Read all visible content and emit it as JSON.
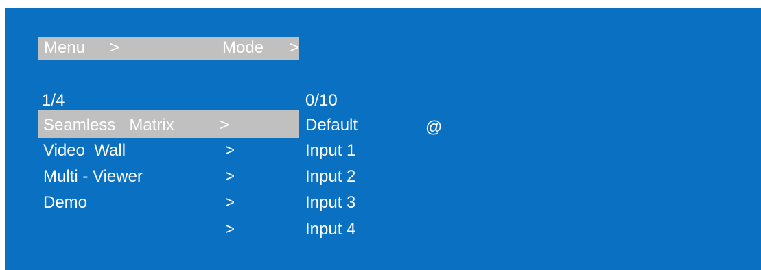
{
  "colors": {
    "background": "#0a70c2",
    "highlight": "#c0c0c0",
    "text": "#ffffff"
  },
  "header": {
    "menu_label": "Menu",
    "menu_arrow": ">",
    "mode_label": "Mode",
    "mode_arrow": ">"
  },
  "left_pager": "1/4",
  "right_pager": "0/10",
  "menu_items": [
    {
      "label": "Seamless   Matrix",
      "arrow": ">"
    },
    {
      "label": "Video  Wall",
      "arrow": ">"
    },
    {
      "label": "Multi - Viewer",
      "arrow": ">"
    },
    {
      "label": "Demo",
      "arrow": ">"
    },
    {
      "label": "",
      "arrow": ">"
    }
  ],
  "mode_items": [
    {
      "label": "Default",
      "marker": "@"
    },
    {
      "label": "Input 1"
    },
    {
      "label": "Input 2"
    },
    {
      "label": "Input 3"
    },
    {
      "label": "Input 4"
    }
  ]
}
